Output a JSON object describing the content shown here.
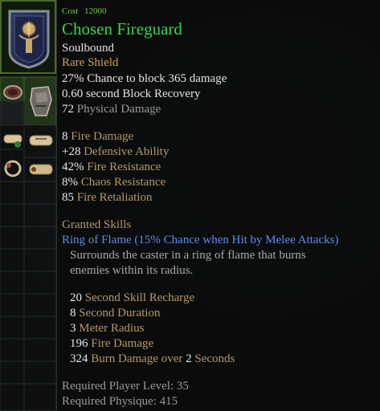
{
  "tooltip": {
    "cost_label": "Cost",
    "cost_value": "12000",
    "item_name": "Chosen Fireguard",
    "binding": "Soulbound",
    "item_type": "Rare Shield",
    "block": {
      "value": "27%",
      "mid": "Chance to block",
      "amount": "365",
      "suffix": "damage"
    },
    "recovery": {
      "value": "0.60",
      "text": "second Block Recovery"
    },
    "physical": {
      "value": "72",
      "text": "Physical Damage"
    },
    "stats": [
      {
        "value": "8",
        "label": "Fire Damage"
      },
      {
        "value": "+28",
        "label": "Defensive Ability"
      },
      {
        "value": "42%",
        "label": "Fire Resistance"
      },
      {
        "value": "8%",
        "label": "Chaos Resistance"
      },
      {
        "value": "85",
        "label": "Fire Retaliation"
      }
    ],
    "granted_heading": "Granted Skills",
    "skill_name": "Ring of Flame (15% Chance when Hit by Melee Attacks)",
    "skill_desc_1": "Surrounds the caster in a ring of flame that burns",
    "skill_desc_2": "enemies within its radius.",
    "skill_stats": [
      {
        "value": "20",
        "label": "Second Skill Recharge"
      },
      {
        "value": "8",
        "label": "Second Duration"
      },
      {
        "value": "3",
        "label": "Meter Radius"
      },
      {
        "value": "196",
        "label": "Fire Damage"
      },
      {
        "value": "324",
        "label": "Burn Damage over",
        "value2": "2",
        "label2": "Seconds"
      }
    ],
    "req_level_label": "Required Player Level:",
    "req_level_value": "35",
    "req_phys_label": "Required Physique:",
    "req_phys_value": "415"
  },
  "icons": {
    "shield": "shield-icon",
    "amulet": "amulet-icon",
    "scroll": "scroll-icon",
    "ring": "ring-icon"
  }
}
